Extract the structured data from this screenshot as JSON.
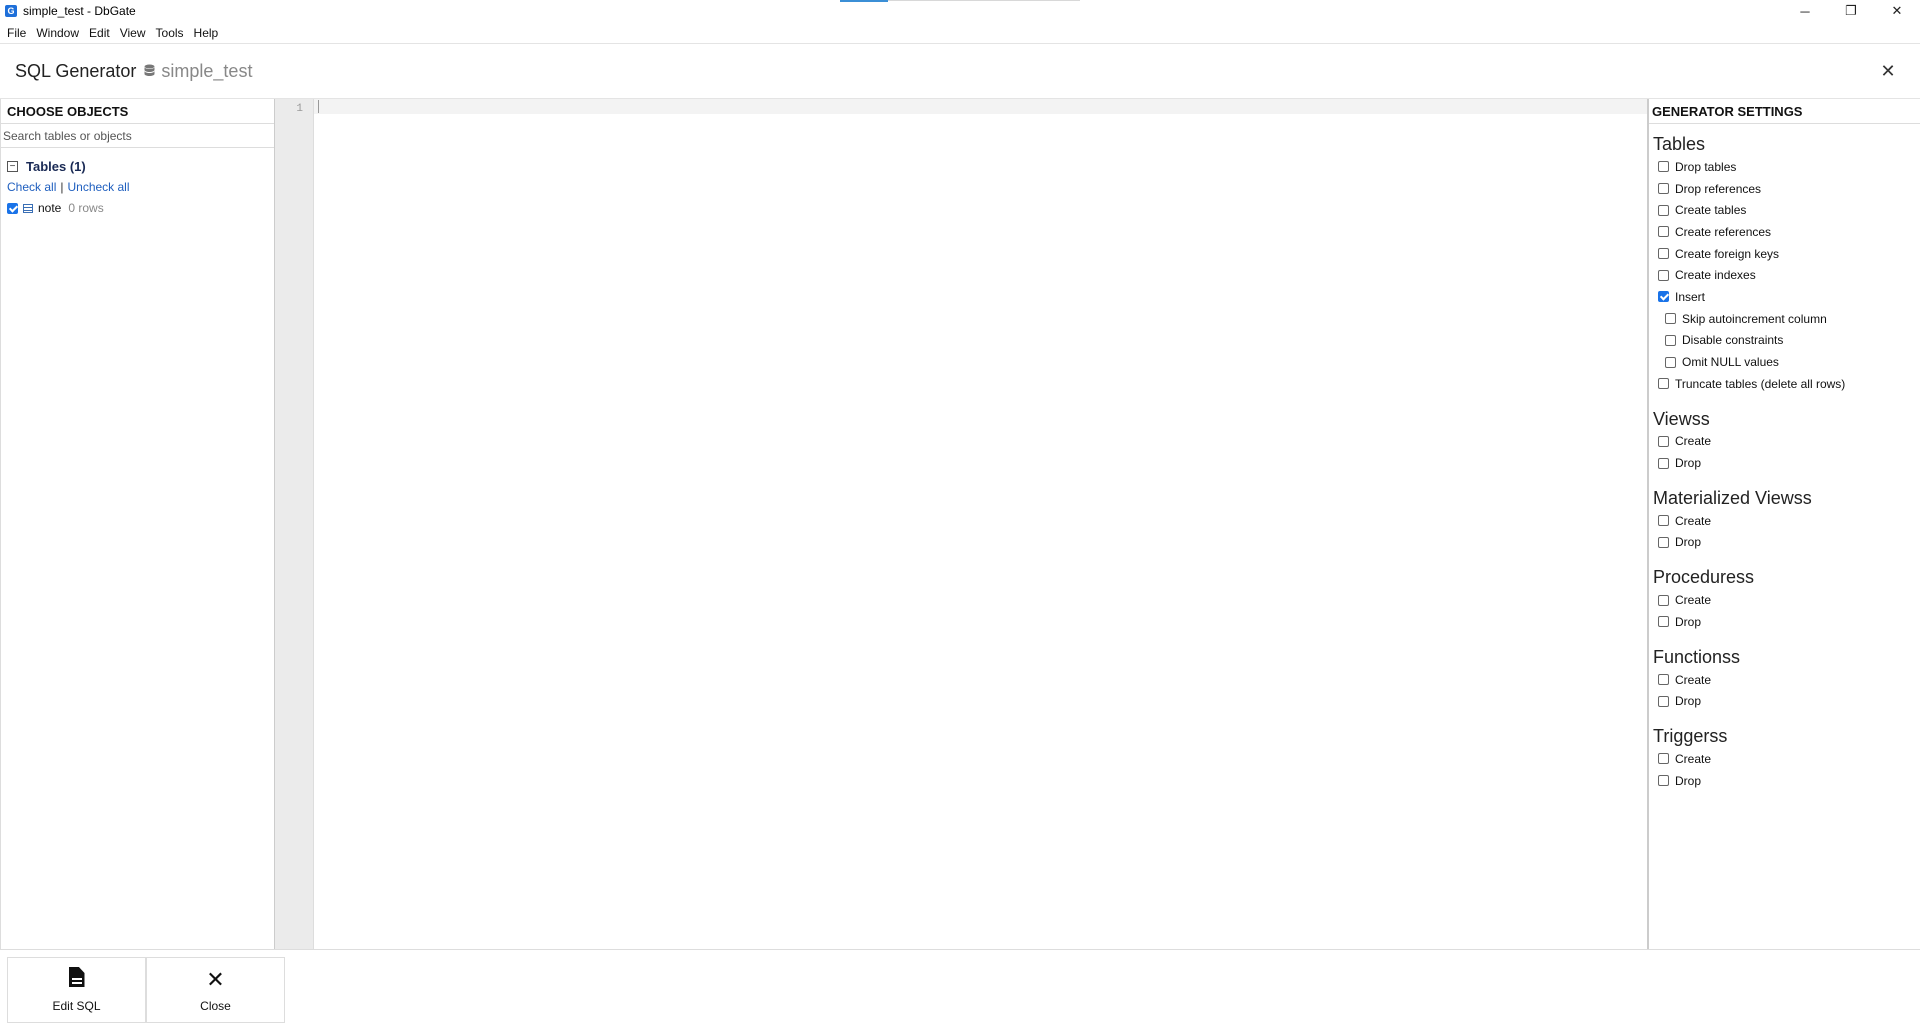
{
  "window": {
    "title": "simple_test - DbGate",
    "app_icon_letter": "G",
    "controls": {
      "minimize": "─",
      "restore": "❐",
      "close": "✕"
    }
  },
  "menu": [
    "File",
    "Window",
    "Edit",
    "View",
    "Tools",
    "Help"
  ],
  "header": {
    "title": "SQL Generator",
    "database": "simple_test",
    "close_glyph": "✕"
  },
  "objects_panel": {
    "heading": "CHOOSE OBJECTS",
    "search_placeholder": "Search tables or objects",
    "group_toggle": "−",
    "group_label": "Tables (1)",
    "check_all": "Check all",
    "separator": "|",
    "uncheck_all": "Uncheck all",
    "items": [
      {
        "name": "note",
        "rows": "0 rows",
        "checked": true
      }
    ]
  },
  "editor": {
    "line_numbers": [
      "1"
    ],
    "content": ""
  },
  "settings_panel": {
    "heading": "GENERATOR SETTINGS",
    "sections": [
      {
        "title": "Tables",
        "options": [
          {
            "label": "Drop tables",
            "checked": false
          },
          {
            "label": "Drop references",
            "checked": false
          },
          {
            "label": "Create tables",
            "checked": false
          },
          {
            "label": "Create references",
            "checked": false
          },
          {
            "label": "Create foreign keys",
            "checked": false
          },
          {
            "label": "Create indexes",
            "checked": false
          },
          {
            "label": "Insert",
            "checked": true
          },
          {
            "label": "Skip autoincrement column",
            "checked": false,
            "sub": true
          },
          {
            "label": "Disable constraints",
            "checked": false,
            "sub": true
          },
          {
            "label": "Omit NULL values",
            "checked": false,
            "sub": true
          },
          {
            "label": "Truncate tables (delete all rows)",
            "checked": false
          }
        ]
      },
      {
        "title": "Viewss",
        "options": [
          {
            "label": "Create",
            "checked": false
          },
          {
            "label": "Drop",
            "checked": false
          }
        ]
      },
      {
        "title": "Materialized Viewss",
        "options": [
          {
            "label": "Create",
            "checked": false
          },
          {
            "label": "Drop",
            "checked": false
          }
        ]
      },
      {
        "title": "Proceduress",
        "options": [
          {
            "label": "Create",
            "checked": false
          },
          {
            "label": "Drop",
            "checked": false
          }
        ]
      },
      {
        "title": "Functionss",
        "options": [
          {
            "label": "Create",
            "checked": false
          },
          {
            "label": "Drop",
            "checked": false
          }
        ]
      },
      {
        "title": "Triggerss",
        "options": [
          {
            "label": "Create",
            "checked": false
          },
          {
            "label": "Drop",
            "checked": false
          }
        ]
      }
    ]
  },
  "toolbar": {
    "edit_sql_label": "Edit SQL",
    "close_label": "Close",
    "close_glyph": "✕"
  },
  "colors": {
    "accent": "#1a73e8",
    "link": "#1f5fbf",
    "gutter": "#ebebeb"
  }
}
